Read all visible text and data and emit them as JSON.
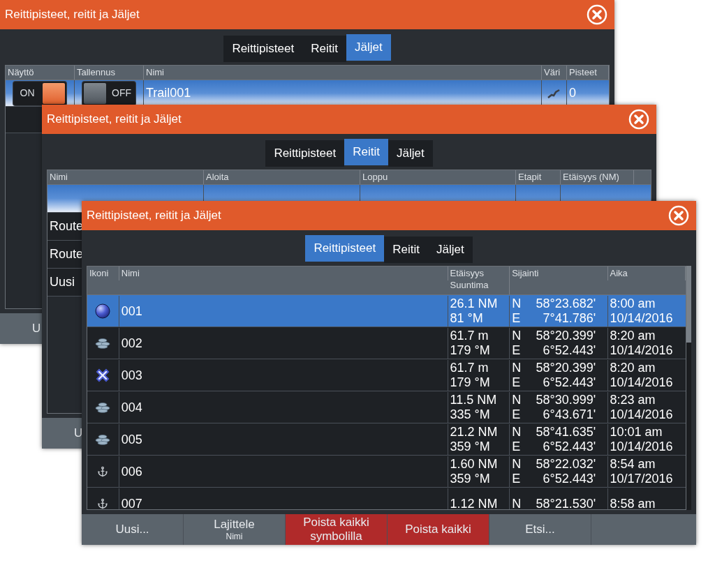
{
  "windows": [
    {
      "kind": "tracks",
      "title": "Reittipisteet, reitit ja Jäljet",
      "tabs": [
        {
          "label": "Reittipisteet",
          "selected": false
        },
        {
          "label": "Reitit",
          "selected": false
        },
        {
          "label": "Jäljet",
          "selected": true
        }
      ],
      "columns": [
        {
          "label": "Näyttö"
        },
        {
          "label": "Tallennus"
        },
        {
          "label": "Nimi"
        },
        {
          "label": "Väri"
        },
        {
          "label": "Pisteet"
        }
      ],
      "rows": [
        {
          "display": {
            "label": "ON",
            "on": true
          },
          "recording": {
            "label": "OFF",
            "on": false
          },
          "name": "Trail001",
          "points": "0",
          "selected": true
        }
      ],
      "buttons": [
        {
          "label": "U",
          "danger": false
        }
      ]
    },
    {
      "kind": "routes",
      "title": "Reittipisteet, reitit ja Jäljet",
      "tabs": [
        {
          "label": "Reittipisteet",
          "selected": false
        },
        {
          "label": "Reitit",
          "selected": true
        },
        {
          "label": "Jäljet",
          "selected": false
        }
      ],
      "columns": [
        {
          "label": "Nimi"
        },
        {
          "label": "Aloita"
        },
        {
          "label": "Loppu"
        },
        {
          "label": "Etapit"
        },
        {
          "label": "Etäisyys (NM)"
        }
      ],
      "rows": [
        {
          "selected": true
        },
        {
          "name": "Route",
          "selected": false
        },
        {
          "name": "Route",
          "selected": false
        },
        {
          "name": "Uusi",
          "selected": false
        }
      ],
      "buttons": [
        {
          "label": "U",
          "danger": false
        }
      ]
    },
    {
      "kind": "waypoints",
      "title": "Reittipisteet, reitit ja Jäljet",
      "tabs": [
        {
          "label": "Reittipisteet",
          "selected": true
        },
        {
          "label": "Reitit",
          "selected": false
        },
        {
          "label": "Jäljet",
          "selected": false
        }
      ],
      "columns": [
        {
          "label": "Ikoni"
        },
        {
          "label": "Nimi"
        },
        {
          "label": "Etäisyys",
          "sublabel": "Suuntima"
        },
        {
          "label": "Sijainti"
        },
        {
          "label": "Aika"
        }
      ],
      "rows": [
        {
          "kind": "sphere",
          "name": "001",
          "distance": "26.1 NM",
          "bearing": "81 °M",
          "lat_hemi": "N",
          "lat": "58°23.682'",
          "lon_hemi": "E",
          "lon": "7°41.786'",
          "time": "8:00 am",
          "date": "10/14/2016",
          "selected": true
        },
        {
          "kind": "fish",
          "name": "002",
          "distance": "61.7 m",
          "bearing": "179 °M",
          "lat_hemi": "N",
          "lat": "58°20.399'",
          "lon_hemi": "E",
          "lon": "6°52.443'",
          "time": "8:20 am",
          "date": "10/14/2016",
          "selected": false
        },
        {
          "kind": "cross",
          "name": "003",
          "distance": "61.7 m",
          "bearing": "179 °M",
          "lat_hemi": "N",
          "lat": "58°20.399'",
          "lon_hemi": "E",
          "lon": "6°52.443'",
          "time": "8:20 am",
          "date": "10/14/2016",
          "selected": false
        },
        {
          "kind": "fish",
          "name": "004",
          "distance": "11.5 NM",
          "bearing": "335 °M",
          "lat_hemi": "N",
          "lat": "58°30.999'",
          "lon_hemi": "E",
          "lon": "6°43.671'",
          "time": "8:23 am",
          "date": "10/14/2016",
          "selected": false
        },
        {
          "kind": "fish",
          "name": "005",
          "distance": "21.2 NM",
          "bearing": "359 °M",
          "lat_hemi": "N",
          "lat": "58°41.635'",
          "lon_hemi": "E",
          "lon": "6°52.443'",
          "time": "10:01 am",
          "date": "10/14/2016",
          "selected": false
        },
        {
          "kind": "anchor",
          "name": "006",
          "distance": "1.60 NM",
          "bearing": "359 °M",
          "lat_hemi": "N",
          "lat": "58°22.032'",
          "lon_hemi": "E",
          "lon": "6°52.443'",
          "time": "8:54 am",
          "date": "10/17/2016",
          "selected": false
        },
        {
          "kind": "anchor",
          "name": "007",
          "distance": "1.12 NM",
          "lat_hemi": "N",
          "lat": "58°21.530'",
          "time": "8:58 am",
          "selected": false
        }
      ],
      "buttons": [
        {
          "label": "Uusi...",
          "danger": false
        },
        {
          "label": "Lajittele",
          "sublabel": "Nimi",
          "danger": false
        },
        {
          "label": "Poista kaikki symbolilla",
          "danger": true
        },
        {
          "label": "Poista kaikki",
          "danger": true
        },
        {
          "label": "Etsi...",
          "danger": false
        }
      ]
    }
  ]
}
